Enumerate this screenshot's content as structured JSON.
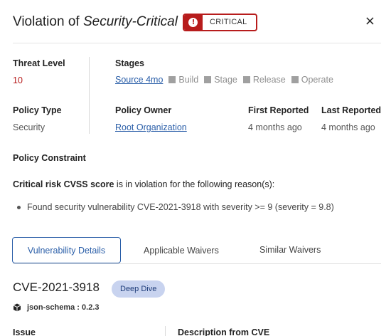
{
  "dialog": {
    "title_prefix": "Violation of ",
    "title_policy": "Security-Critical",
    "severity_badge": "CRITICAL",
    "severity_color": "#b71c1c",
    "close_icon": "×"
  },
  "summary": {
    "threat_level_label": "Threat Level",
    "threat_level_value": "10",
    "stages_label": "Stages",
    "stages": [
      {
        "name": "Source 4mo",
        "active": true
      },
      {
        "name": "Build",
        "active": false
      },
      {
        "name": "Stage",
        "active": false
      },
      {
        "name": "Release",
        "active": false
      },
      {
        "name": "Operate",
        "active": false
      }
    ],
    "policy_type_label": "Policy Type",
    "policy_type_value": "Security",
    "policy_owner_label": "Policy Owner",
    "policy_owner_value": "Root Organization",
    "first_reported_label": "First Reported",
    "first_reported_value": "4 months ago",
    "last_reported_label": "Last Reported",
    "last_reported_value": "4 months ago"
  },
  "constraint": {
    "heading": "Policy Constraint",
    "condition_bold": "Critical risk CVSS score",
    "condition_rest": " is in violation for the following reason(s):",
    "reasons": [
      "Found security vulnerability CVE-2021-3918 with severity >= 9 (severity = 9.8)"
    ]
  },
  "tabs": {
    "vulnerability_details": "Vulnerability Details",
    "applicable_waivers": "Applicable Waivers",
    "similar_waivers": "Similar Waivers"
  },
  "vulnerability": {
    "id": "CVE-2021-3918",
    "deep_dive_label": "Deep Dive",
    "package": "json-schema : 0.2.3",
    "issue_label": "Issue",
    "description_label": "Description from CVE"
  }
}
